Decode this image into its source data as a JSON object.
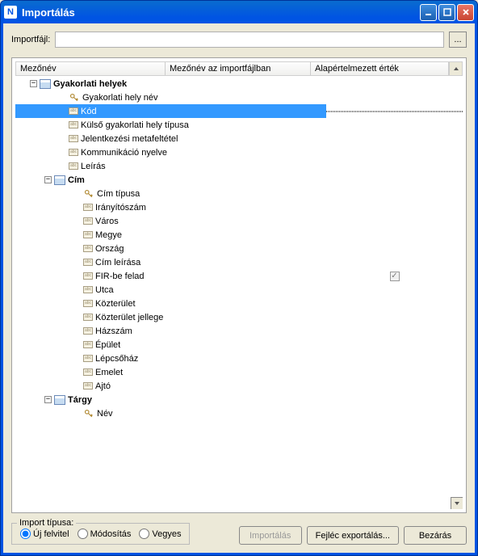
{
  "window": {
    "title": "Importálás"
  },
  "importFile": {
    "label": "Importfájl:",
    "value": ""
  },
  "columns": {
    "c1": "Mezőnév",
    "c2": "Mezőnév az importfájlban",
    "c3": "Alapértelmezett érték"
  },
  "tree": {
    "root0": {
      "label": "Gyakorlati helyek",
      "children": {
        "i0": "Gyakorlati hely név",
        "i1": "Kód",
        "i2": "Külső gyakorlati hely típusa",
        "i3": "Jelentkezési metafeltétel",
        "i4": "Kommunikáció nyelve",
        "i5": "Leírás"
      }
    },
    "cim": {
      "label": "Cím",
      "children": {
        "c0": "Cím típusa",
        "c1": "Irányítószám",
        "c2": "Város",
        "c3": "Megye",
        "c4": "Ország",
        "c5": "Cím leírása",
        "c6": "FIR-be felad",
        "c7": "Utca",
        "c8": "Közterület",
        "c9": "Közterület jellege",
        "c10": "Házszám",
        "c11": "Épület",
        "c12": "Lépcsőház",
        "c13": "Emelet",
        "c14": "Ajtó"
      }
    },
    "targy": {
      "label": "Tárgy",
      "children": {
        "t0": "Név"
      }
    }
  },
  "importType": {
    "title": "Import típusa:",
    "opt1": "Új felvitel",
    "opt2": "Módosítás",
    "opt3": "Vegyes"
  },
  "buttons": {
    "import": "Importálás",
    "export": "Fejléc exportálás...",
    "close": "Bezárás"
  }
}
